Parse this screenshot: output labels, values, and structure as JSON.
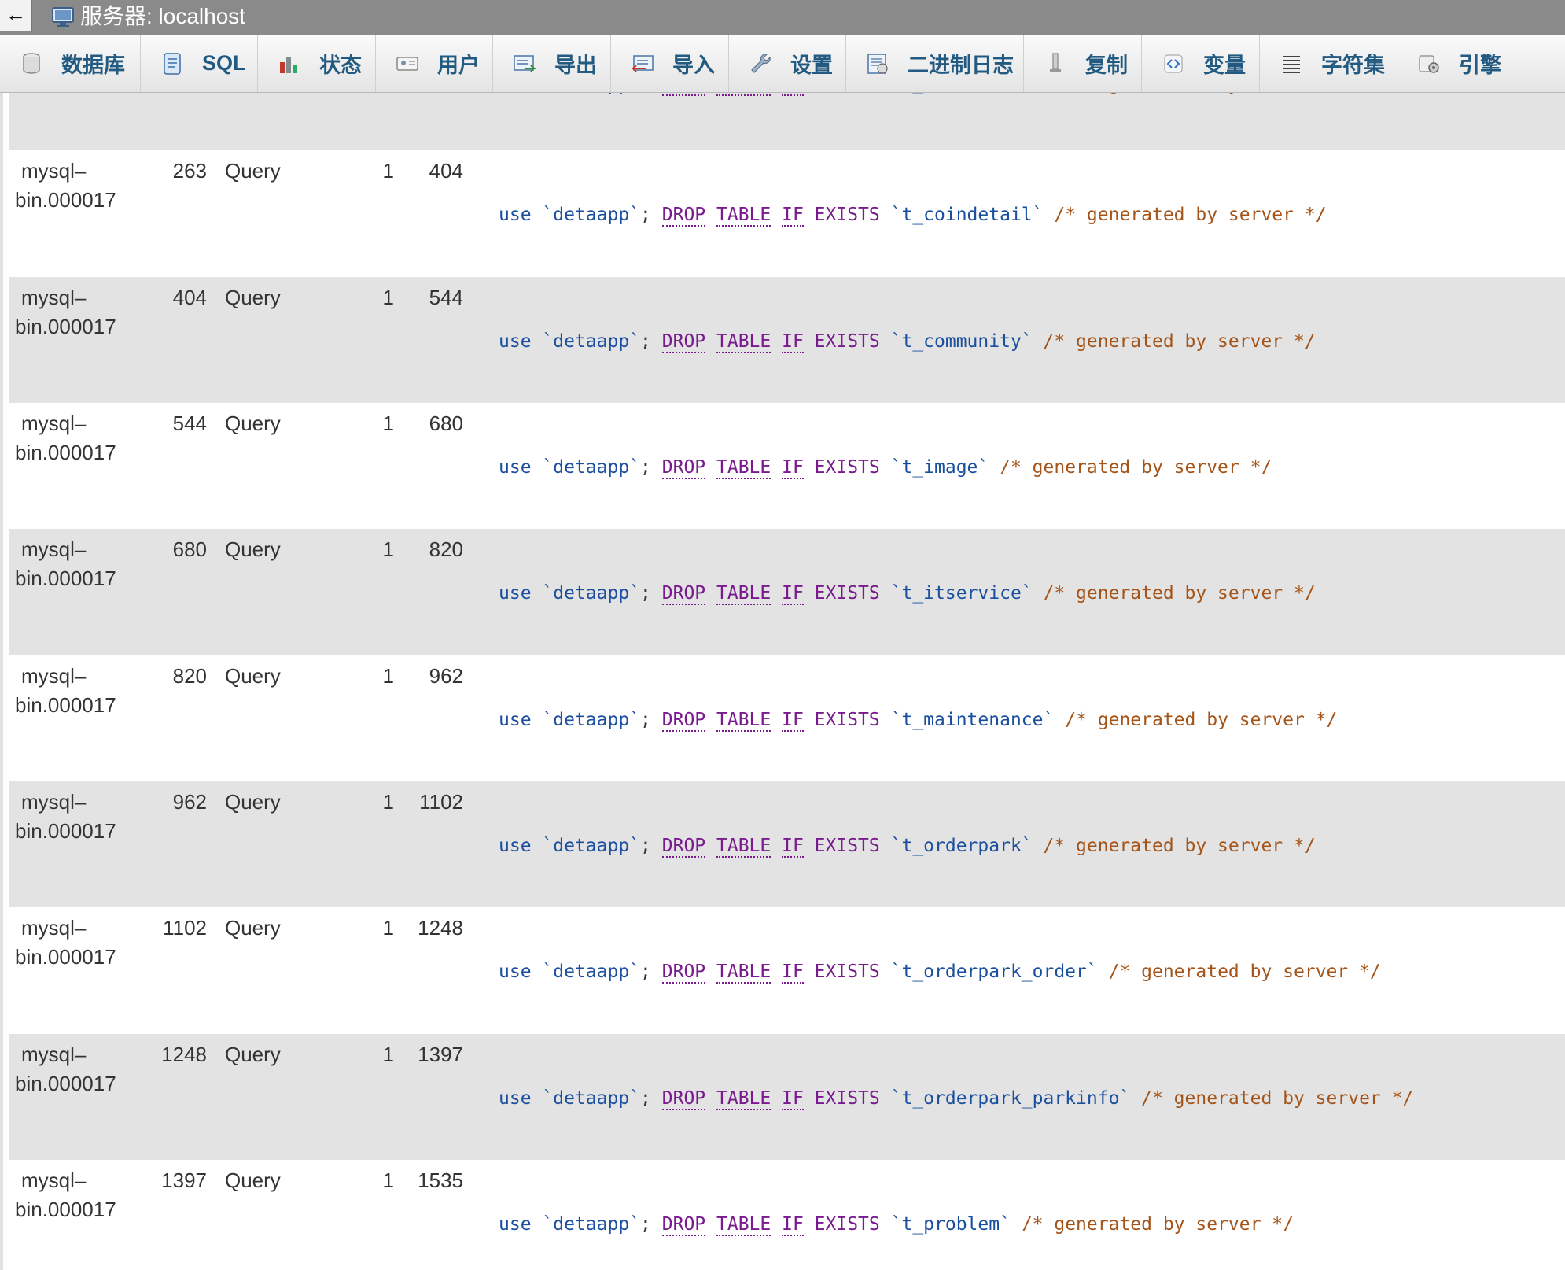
{
  "window": {
    "back_glyph": "←",
    "title": "服务器: localhost"
  },
  "tabs": [
    {
      "label": "数据库",
      "icon": "database-icon"
    },
    {
      "label": "SQL",
      "icon": "sql-icon"
    },
    {
      "label": "状态",
      "icon": "status-chart-icon"
    },
    {
      "label": "用户",
      "icon": "users-icon"
    },
    {
      "label": "导出",
      "icon": "export-icon"
    },
    {
      "label": "导入",
      "icon": "import-icon"
    },
    {
      "label": "设置",
      "icon": "wrench-icon"
    },
    {
      "label": "二进制日志",
      "icon": "binlog-icon"
    },
    {
      "label": "复制",
      "icon": "replication-icon"
    },
    {
      "label": "变量",
      "icon": "variables-icon"
    },
    {
      "label": "字符集",
      "icon": "charset-icon"
    },
    {
      "label": "引擎",
      "icon": "engine-icon"
    }
  ],
  "binlog": {
    "partial_top_row": {
      "database": "detaapp",
      "table": "t_announcement"
    },
    "sql": {
      "use": "use",
      "drop": "DROP",
      "table_kw": "TABLE",
      "if_kw": "IF",
      "exists": "EXISTS",
      "comment": "/* generated by server */"
    },
    "rows": [
      {
        "log_name": [
          "mysql–",
          "bin.000017"
        ],
        "pos": "263",
        "event_type": "Query",
        "server_id": "1",
        "end_log_pos": "404",
        "database": "detaapp",
        "table": "t_coindetail"
      },
      {
        "log_name": [
          "mysql–",
          "bin.000017"
        ],
        "pos": "404",
        "event_type": "Query",
        "server_id": "1",
        "end_log_pos": "544",
        "database": "detaapp",
        "table": "t_community"
      },
      {
        "log_name": [
          "mysql–",
          "bin.000017"
        ],
        "pos": "544",
        "event_type": "Query",
        "server_id": "1",
        "end_log_pos": "680",
        "database": "detaapp",
        "table": "t_image"
      },
      {
        "log_name": [
          "mysql–",
          "bin.000017"
        ],
        "pos": "680",
        "event_type": "Query",
        "server_id": "1",
        "end_log_pos": "820",
        "database": "detaapp",
        "table": "t_itservice"
      },
      {
        "log_name": [
          "mysql–",
          "bin.000017"
        ],
        "pos": "820",
        "event_type": "Query",
        "server_id": "1",
        "end_log_pos": "962",
        "database": "detaapp",
        "table": "t_maintenance"
      },
      {
        "log_name": [
          "mysql–",
          "bin.000017"
        ],
        "pos": "962",
        "event_type": "Query",
        "server_id": "1",
        "end_log_pos": "1102",
        "database": "detaapp",
        "table": "t_orderpark"
      },
      {
        "log_name": [
          "mysql–",
          "bin.000017"
        ],
        "pos": "1102",
        "event_type": "Query",
        "server_id": "1",
        "end_log_pos": "1248",
        "database": "detaapp",
        "table": "t_orderpark_order"
      },
      {
        "log_name": [
          "mysql–",
          "bin.000017"
        ],
        "pos": "1248",
        "event_type": "Query",
        "server_id": "1",
        "end_log_pos": "1397",
        "database": "detaapp",
        "table": "t_orderpark_parkinfo"
      },
      {
        "log_name": [
          "mysql–",
          "bin.000017"
        ],
        "pos": "1397",
        "event_type": "Query",
        "server_id": "1",
        "end_log_pos": "1535",
        "database": "detaapp",
        "table": "t_problem"
      }
    ]
  }
}
